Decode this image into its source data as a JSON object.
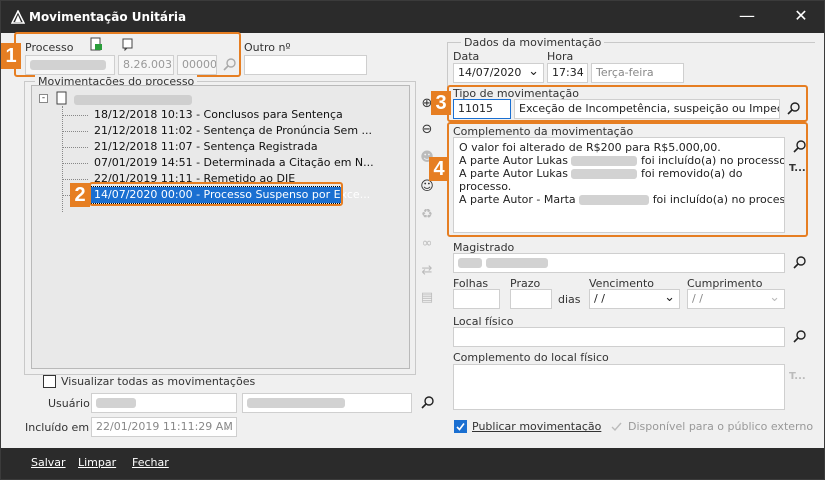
{
  "window": {
    "title": "Movimentação Unitária"
  },
  "processo": {
    "label": "Processo",
    "num_mid": "8.26.0037",
    "num_end": "00000",
    "outro_label": "Outro nº"
  },
  "movimentacoes": {
    "group_label": "Movimentações do processo",
    "rows": [
      "18/12/2018 10:13 - Conclusos para Sentença",
      "21/12/2018 11:02 - Sentença de Pronúncia Sem ...",
      "21/12/2018 11:07 - Sentença Registrada",
      "07/01/2019 14:51 - Determinada a Citação em N...",
      "22/01/2019 11:11 - Remetido ao DJE"
    ],
    "selected": "14/07/2020 00:00 - Processo Suspenso por Exce..."
  },
  "visualizar_label": "Visualizar todas as movimentações",
  "usuario_label": "Usuário",
  "incluido_label": "Incluído em :",
  "incluido_value": "22/01/2019 11:11:29 AM",
  "dados": {
    "group_label": "Dados da movimentação",
    "data_label": "Data",
    "data_value": "14/07/2020",
    "hora_label": "Hora",
    "hora_value": "17:34",
    "dia_value": "Terça-feira",
    "tipo_label": "Tipo de movimentação",
    "tipo_code": "11015",
    "tipo_desc": "Exceção de Incompetência, suspeição ou Impedimer",
    "complemento_label": "Complemento da movimentação",
    "complemento_l1": "O valor foi alterado de R$200 para R$5.000,00.",
    "complemento_l2a": "A parte Autor Lukas",
    "complemento_l2b": "foi incluído(a) no processo.",
    "complemento_l3a": "A parte Autor Lukas",
    "complemento_l3b": "foi removido(a) do",
    "complemento_l4": "processo.",
    "complemento_l5a": "A parte Autor - Marta",
    "complemento_l5b": "foi incluído(a) no processo.",
    "t_label": "T...",
    "magistrado_label": "Magistrado",
    "folhas_label": "Folhas",
    "prazo_label": "Prazo",
    "dias_label": "dias",
    "vencimento_label": "Vencimento",
    "vencimento_value": "/ /",
    "cumprimento_label": "Cumprimento",
    "cumprimento_value": "/ /",
    "local_label": "Local físico",
    "complemento_local_label": "Complemento do local físico",
    "publicar_label": "Publicar movimentação",
    "disponivel_label": "Disponível para o público externo"
  },
  "callouts": [
    "1",
    "2",
    "3",
    "4"
  ],
  "buttons": {
    "salvar": "Salvar",
    "limpar": "Limpar",
    "fechar": "Fechar"
  },
  "colors": {
    "accent": "#e67e22",
    "selection": "#1a6fd1",
    "titlebar": "#2b2b2b"
  }
}
